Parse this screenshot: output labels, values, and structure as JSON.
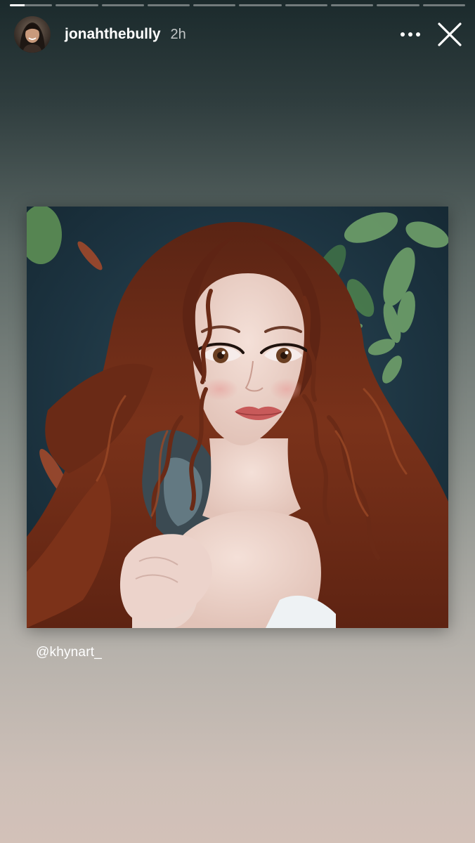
{
  "story": {
    "progress": [
      0.35,
      0,
      0,
      0,
      0,
      0,
      0,
      0,
      0,
      0
    ],
    "username": "jonahthebully",
    "timestamp": "2h",
    "mention": "@khynart_"
  },
  "icons": {
    "more": "more-horizontal-icon",
    "close": "close-icon"
  },
  "colors": {
    "progress_active": "#ffffff",
    "progress_inactive": "rgba(255,255,255,0.38)",
    "text": "#ffffff"
  }
}
